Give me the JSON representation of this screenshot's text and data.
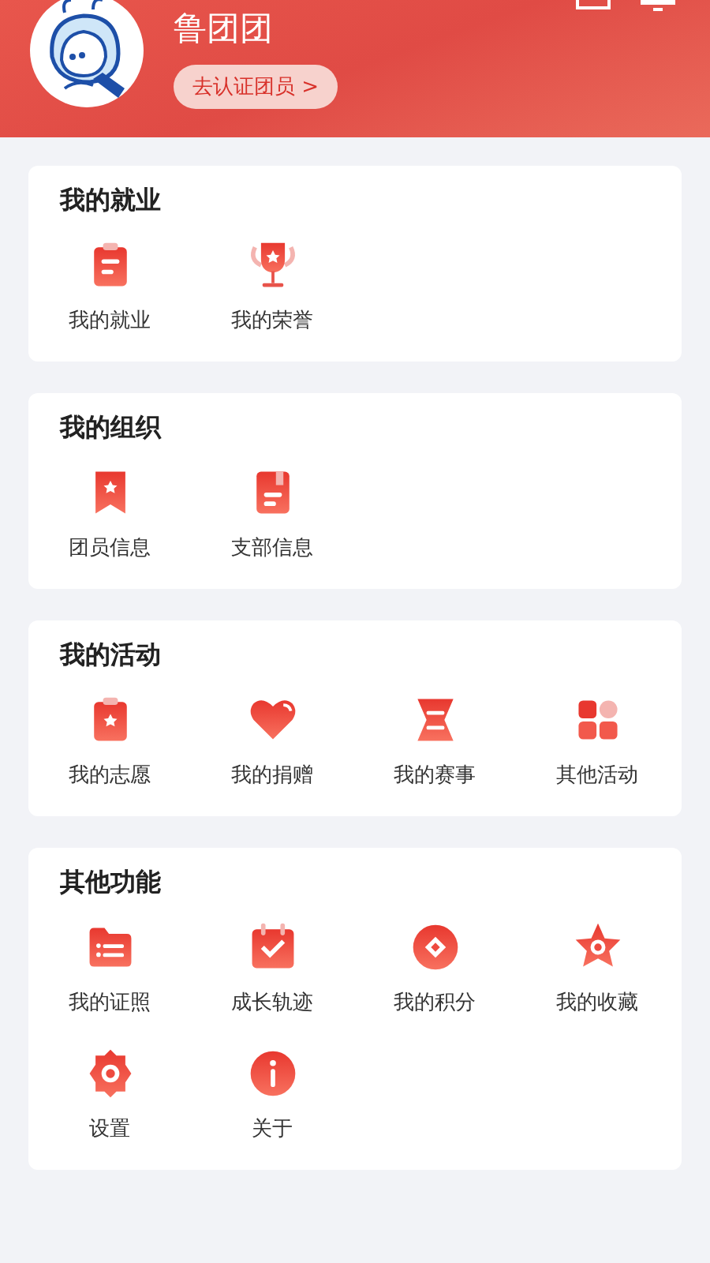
{
  "profile": {
    "name": "鲁团团",
    "verify_button": "去认证团员 >"
  },
  "sections": [
    {
      "title": "我的就业",
      "items": [
        {
          "label": "我的就业",
          "kind": "clipboard"
        },
        {
          "label": "我的荣誉",
          "kind": "trophy"
        }
      ]
    },
    {
      "title": "我的组织",
      "items": [
        {
          "label": "团员信息",
          "kind": "bookmark"
        },
        {
          "label": "支部信息",
          "kind": "book"
        }
      ]
    },
    {
      "title": "我的活动",
      "items": [
        {
          "label": "我的志愿",
          "kind": "starclip"
        },
        {
          "label": "我的捐赠",
          "kind": "heart"
        },
        {
          "label": "我的赛事",
          "kind": "hourglass"
        },
        {
          "label": "其他活动",
          "kind": "grid"
        }
      ]
    },
    {
      "title": "其他功能",
      "items": [
        {
          "label": "我的证照",
          "kind": "folder"
        },
        {
          "label": "成长轨迹",
          "kind": "calendar"
        },
        {
          "label": "我的积分",
          "kind": "coin"
        },
        {
          "label": "我的收藏",
          "kind": "star"
        },
        {
          "label": "设置",
          "kind": "gear"
        },
        {
          "label": "关于",
          "kind": "info"
        }
      ]
    }
  ]
}
